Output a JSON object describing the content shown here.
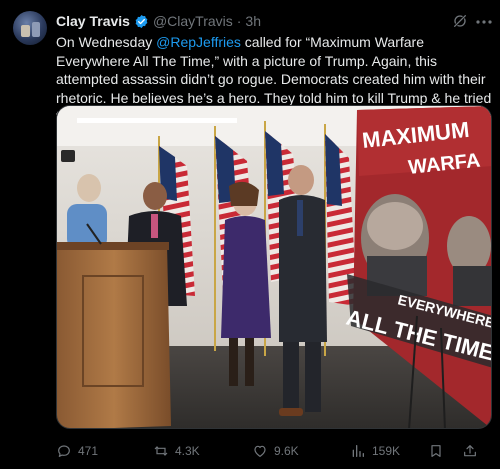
{
  "author": {
    "name": "Clay Travis",
    "handle": "@ClayTravis",
    "separator": "·",
    "time": "3h"
  },
  "tweet": {
    "text_before": "On Wednesday ",
    "mention": "@RepJeffries",
    "text_after": " called for “Maximum Warfare Everywhere All The Time,” with a picture of Trump. Again, this attempted assassin didn’t go rogue. Democrats created him with their rhetoric. He believes he’s a hero. They told him to kill Trump & he tried to do it."
  },
  "media": {
    "poster_line1": "MAXIMUM",
    "poster_line2": "WARFA",
    "poster_line3": "EVERYWHERE",
    "poster_line4": "ALL THE TIME"
  },
  "actions": {
    "replies": "471",
    "reposts": "4.3K",
    "likes": "9.6K",
    "views": "159K"
  },
  "colors": {
    "background": "#000000",
    "text": "#e7e9ea",
    "muted": "#71767b",
    "link": "#1d9bf0",
    "verified": "#1d9bf0"
  },
  "icons": [
    "verified-badge-icon",
    "grok-icon",
    "more-icon",
    "reply-icon",
    "repost-icon",
    "like-icon",
    "views-icon"
  ]
}
